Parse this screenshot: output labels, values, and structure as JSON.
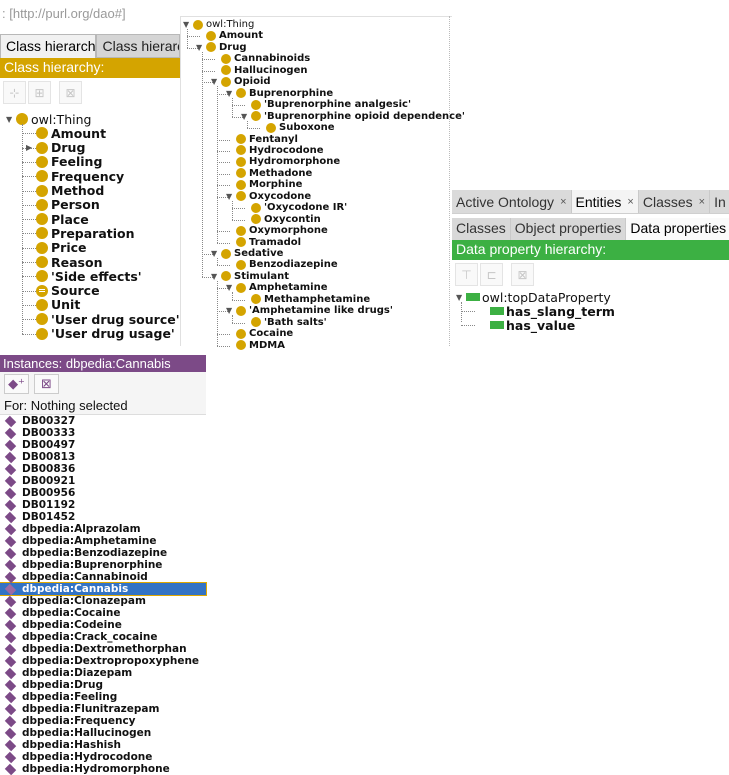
{
  "ontology_prefix": ": [http://purl.org/dao#]",
  "class_panel": {
    "tabs": [
      {
        "label": "Class hierarchy",
        "active": true
      },
      {
        "label": "Class hierarc",
        "active": false
      }
    ],
    "header": "Class hierarchy:",
    "header_color": "#d4a400",
    "toolbar": [
      "add-subclass-icon",
      "add-sibling-class-icon",
      "delete-class-icon"
    ],
    "root": "owl:Thing",
    "children": [
      {
        "label": "Amount"
      },
      {
        "label": "Drug",
        "collapsed": true
      },
      {
        "label": "Feeling"
      },
      {
        "label": "Frequency"
      },
      {
        "label": "Method"
      },
      {
        "label": "Person"
      },
      {
        "label": "Place"
      },
      {
        "label": "Preparation"
      },
      {
        "label": "Price"
      },
      {
        "label": "Reason"
      },
      {
        "label": "'Side effects'"
      },
      {
        "label": "Source",
        "defined": true
      },
      {
        "label": "Unit"
      },
      {
        "label": "'User drug source'"
      },
      {
        "label": "'User drug usage'"
      }
    ]
  },
  "drug_tree": {
    "root": "owl:Thing",
    "nodes": [
      {
        "label": "Amount",
        "depth": 1
      },
      {
        "label": "Drug",
        "depth": 1,
        "expanded": true
      },
      {
        "label": "Cannabinoids",
        "depth": 2
      },
      {
        "label": "Hallucinogen",
        "depth": 2
      },
      {
        "label": "Opioid",
        "depth": 2,
        "expanded": true
      },
      {
        "label": "Buprenorphine",
        "depth": 3,
        "expanded": true
      },
      {
        "label": "'Buprenorphine analgesic'",
        "depth": 4
      },
      {
        "label": "'Buprenorphine opioid dependence'",
        "depth": 4,
        "expanded": true
      },
      {
        "label": "Suboxone",
        "depth": 5
      },
      {
        "label": "Fentanyl",
        "depth": 3
      },
      {
        "label": "Hydrocodone",
        "depth": 3
      },
      {
        "label": "Hydromorphone",
        "depth": 3
      },
      {
        "label": "Methadone",
        "depth": 3
      },
      {
        "label": "Morphine",
        "depth": 3
      },
      {
        "label": "Oxycodone",
        "depth": 3,
        "expanded": true
      },
      {
        "label": "'Oxycodone IR'",
        "depth": 4
      },
      {
        "label": "Oxycontin",
        "depth": 4
      },
      {
        "label": "Oxymorphone",
        "depth": 3
      },
      {
        "label": "Tramadol",
        "depth": 3
      },
      {
        "label": "Sedative",
        "depth": 2,
        "expanded": true
      },
      {
        "label": "Benzodiazepine",
        "depth": 3
      },
      {
        "label": "Stimulant",
        "depth": 2,
        "expanded": true
      },
      {
        "label": "Amphetamine",
        "depth": 3,
        "expanded": true
      },
      {
        "label": "Methamphetamine",
        "depth": 4
      },
      {
        "label": "'Amphetamine like drugs'",
        "depth": 3,
        "expanded": true
      },
      {
        "label": "'Bath salts'",
        "depth": 4
      },
      {
        "label": "Cocaine",
        "depth": 3
      },
      {
        "label": "MDMA",
        "depth": 3
      }
    ]
  },
  "data_property_panel": {
    "tabs": [
      {
        "label": "Active Ontology",
        "closable": true
      },
      {
        "label": "Entities",
        "closable": true,
        "active": true
      },
      {
        "label": "Classes",
        "closable": true
      },
      {
        "label": "In",
        "closable": false
      }
    ],
    "close_glyph": "×",
    "subtabs": [
      {
        "label": "Classes"
      },
      {
        "label": "Object properties"
      },
      {
        "label": "Data properties",
        "active": true
      }
    ],
    "header": "Data property hierarchy:",
    "header_color": "#3cb043",
    "toolbar": [
      "add-sub-property-icon",
      "add-sibling-property-icon",
      "delete-property-icon"
    ],
    "root": "owl:topDataProperty",
    "children": [
      "has_slang_term",
      "has_value"
    ]
  },
  "instances_panel": {
    "header": "Instances: dbpedia:Cannabis",
    "header_color": "#7c4a87",
    "toolbar": [
      "add-individual-icon",
      "delete-individual-icon"
    ],
    "for_label": "For: Nothing selected",
    "selected": "dbpedia:Cannabis",
    "items": [
      "DB00327",
      "DB00333",
      "DB00497",
      "DB00813",
      "DB00836",
      "DB00921",
      "DB00956",
      "DB01192",
      "DB01452",
      "dbpedia:Alprazolam",
      "dbpedia:Amphetamine",
      "dbpedia:Benzodiazepine",
      "dbpedia:Buprenorphine",
      "dbpedia:Cannabinoid",
      "dbpedia:Cannabis",
      "dbpedia:Clonazepam",
      "dbpedia:Cocaine",
      "dbpedia:Codeine",
      "dbpedia:Crack_cocaine",
      "dbpedia:Dextromethorphan",
      "dbpedia:Dextropropoxyphene",
      "dbpedia:Diazepam",
      "dbpedia:Drug",
      "dbpedia:Feeling",
      "dbpedia:Flunitrazepam",
      "dbpedia:Frequency",
      "dbpedia:Hallucinogen",
      "dbpedia:Hashish",
      "dbpedia:Hydrocodone",
      "dbpedia:Hydromorphone"
    ]
  }
}
